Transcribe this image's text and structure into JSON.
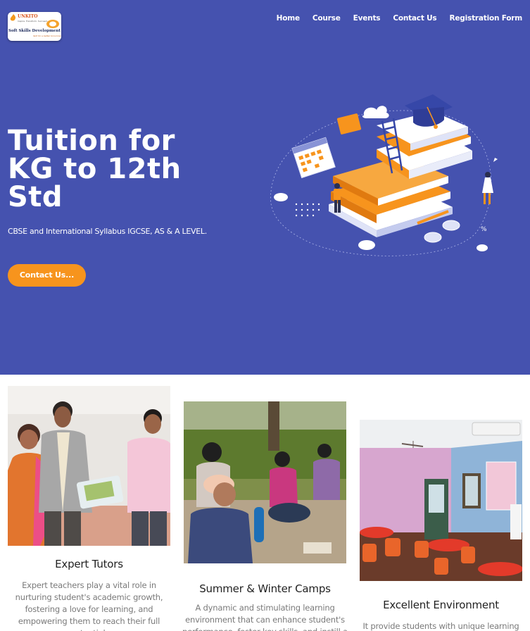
{
  "header": {
    "logo": {
      "brand": "UNKITO",
      "tagline_top": "Inspire. Transform. Succeed.",
      "title": "Soft Skills Development",
      "tagline_bottom": "Skill for a better tomorrow"
    },
    "nav": [
      "Home",
      "Course",
      "Events",
      "Contact Us",
      "Registration Form"
    ]
  },
  "hero": {
    "title": "Tuition for KG to 12th Std",
    "subtitle": "CBSE and International Syllabus IGCSE, AS & A LEVEL.",
    "cta": "Contact Us...",
    "illustration": "education-books-illustration"
  },
  "features": [
    {
      "title": "Expert Tutors",
      "text": "Expert teachers play a vital role in nurturing student's academic growth, fostering a love for learning, and empowering them to reach their full potential.",
      "photo": "award-ceremony-photo"
    },
    {
      "title": "Summer & Winter Camps",
      "text": "A dynamic and stimulating learning environment that can enhance student's performance, foster key skills, and instill a",
      "photo": "outdoor-camp-photo"
    },
    {
      "title": "Excellent Environment",
      "text": "It provide students with unique learning",
      "photo": "classroom-photo"
    }
  ],
  "colors": {
    "hero_bg": "#4552af",
    "accent": "#f7941d",
    "text_muted": "#7a7a7a"
  }
}
